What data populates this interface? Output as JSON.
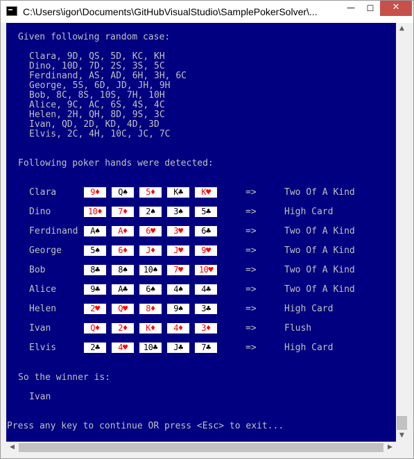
{
  "window": {
    "title": "C:\\Users\\igor\\Documents\\GitHubVisualStudio\\SamplePokerSolver\\..."
  },
  "console": {
    "intro": "Given following random case:",
    "raw_lines": [
      "Clara, 9D, QS, 5D, KC, KH",
      "Dino, 10D, 7D, 2S, 3S, 5C",
      "Ferdinand, AS, AD, 6H, 3H, 6C",
      "George, 5S, 6D, JD, JH, 9H",
      "Bob, 8C, 8S, 10S, 7H, 10H",
      "Alice, 9C, AC, 6S, 4S, 4C",
      "Helen, 2H, QH, 8D, 9S, 3C",
      "Ivan, QD, 2D, KD, 4D, 3D",
      "Elvis, 2C, 4H, 10C, JC, 7C"
    ],
    "detected_header": "Following poker hands were detected:",
    "arrow": "=>",
    "players": [
      {
        "name": "Clara",
        "cards": [
          {
            "t": "9♦",
            "c": "red"
          },
          {
            "t": "Q♠",
            "c": "black"
          },
          {
            "t": "5♦",
            "c": "red"
          },
          {
            "t": "K♣",
            "c": "black"
          },
          {
            "t": "K♥",
            "c": "red"
          }
        ],
        "hand": "Two Of A Kind"
      },
      {
        "name": "Dino",
        "cards": [
          {
            "t": "10♦",
            "c": "red"
          },
          {
            "t": "7♦",
            "c": "red"
          },
          {
            "t": "2♠",
            "c": "black"
          },
          {
            "t": "3♠",
            "c": "black"
          },
          {
            "t": "5♣",
            "c": "black"
          }
        ],
        "hand": "High Card"
      },
      {
        "name": "Ferdinand",
        "cards": [
          {
            "t": "A♠",
            "c": "black"
          },
          {
            "t": "A♦",
            "c": "red"
          },
          {
            "t": "6♥",
            "c": "red"
          },
          {
            "t": "3♥",
            "c": "red"
          },
          {
            "t": "6♣",
            "c": "black"
          }
        ],
        "hand": "Two Of A Kind"
      },
      {
        "name": "George",
        "cards": [
          {
            "t": "5♠",
            "c": "black"
          },
          {
            "t": "6♦",
            "c": "red"
          },
          {
            "t": "J♦",
            "c": "red"
          },
          {
            "t": "J♥",
            "c": "red"
          },
          {
            "t": "9♥",
            "c": "red"
          }
        ],
        "hand": "Two Of A Kind"
      },
      {
        "name": "Bob",
        "cards": [
          {
            "t": "8♣",
            "c": "black"
          },
          {
            "t": "8♠",
            "c": "black"
          },
          {
            "t": "10♠",
            "c": "black"
          },
          {
            "t": "7♥",
            "c": "red"
          },
          {
            "t": "10♥",
            "c": "red"
          }
        ],
        "hand": "Two Of A Kind"
      },
      {
        "name": "Alice",
        "cards": [
          {
            "t": "9♣",
            "c": "black"
          },
          {
            "t": "A♣",
            "c": "black"
          },
          {
            "t": "6♠",
            "c": "black"
          },
          {
            "t": "4♠",
            "c": "black"
          },
          {
            "t": "4♣",
            "c": "black"
          }
        ],
        "hand": "Two Of A Kind"
      },
      {
        "name": "Helen",
        "cards": [
          {
            "t": "2♥",
            "c": "red"
          },
          {
            "t": "Q♥",
            "c": "red"
          },
          {
            "t": "8♦",
            "c": "red"
          },
          {
            "t": "9♠",
            "c": "black"
          },
          {
            "t": "3♣",
            "c": "black"
          }
        ],
        "hand": "High Card"
      },
      {
        "name": "Ivan",
        "cards": [
          {
            "t": "Q♦",
            "c": "red"
          },
          {
            "t": "2♦",
            "c": "red"
          },
          {
            "t": "K♦",
            "c": "red"
          },
          {
            "t": "4♦",
            "c": "red"
          },
          {
            "t": "3♦",
            "c": "red"
          }
        ],
        "hand": "Flush"
      },
      {
        "name": "Elvis",
        "cards": [
          {
            "t": "2♣",
            "c": "black"
          },
          {
            "t": "4♥",
            "c": "red"
          },
          {
            "t": "10♣",
            "c": "black"
          },
          {
            "t": "J♣",
            "c": "black"
          },
          {
            "t": "7♣",
            "c": "black"
          }
        ],
        "hand": "High Card"
      }
    ],
    "winner_header": "So the winner is:",
    "winner": "Ivan",
    "prompt": "Press any key to continue OR press <Esc> to exit..."
  },
  "colors": {
    "console_bg": "#000080",
    "console_fg": "#c0c0c0",
    "card_red": "#ff0000",
    "card_black": "#000000",
    "card_bg": "#ffffff"
  },
  "icons": {
    "app": "console-app-icon",
    "minimize": "minimize-icon",
    "maximize": "maximize-icon",
    "close": "close-icon"
  }
}
